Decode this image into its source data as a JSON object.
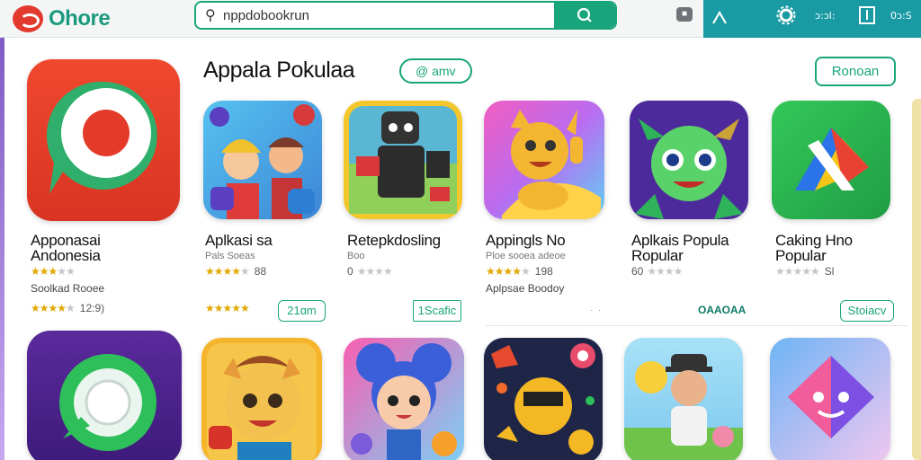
{
  "header": {
    "logo_text": "Ohore",
    "search_value": "nppdobookrun",
    "search_button_icon": "search-icon",
    "right_labels": [
      "ɔ:ɔl:",
      "0ɔ:S"
    ]
  },
  "section": {
    "title": "Appala Pokulaa",
    "chip_label": "@ amv",
    "button_label": "Ronoan"
  },
  "featured": {
    "name_line1": "Apponasai",
    "name_line2": "Andonesia",
    "rating": 3.5,
    "sub": "Soolkad Rooee",
    "rating2": 4.0,
    "rating2_value": "12:9)"
  },
  "apps_row1": [
    {
      "name_line1": "Aplkasi sa",
      "name_line2": "",
      "sub": "Pals Soeas",
      "rating": 4.5,
      "rating_value": "88",
      "extra": "",
      "rating2": 5.0,
      "button": "21ɑm"
    },
    {
      "name_line1": "Retepkdosling",
      "name_line2": "",
      "sub": "Boo",
      "rating": 0.0,
      "rating_value": "",
      "prefix": "0",
      "extra": "",
      "button": "1Scafic"
    },
    {
      "name_line1": "Appingls No",
      "name_line2": "",
      "sub": "Ploe sooea adeoe",
      "rating": 4.0,
      "rating_value": "198",
      "extra": "Aplpsae Boodoy",
      "button": ""
    },
    {
      "name_line1": "Aplkais Popula",
      "name_line2": "Ropular",
      "sub": "",
      "rating": 0.0,
      "rating_value": "",
      "prefix": "60",
      "extra": "",
      "link": "OAAOAA"
    },
    {
      "name_line1": "Caking Hno",
      "name_line2": "Popular",
      "sub": "",
      "rating": 0.0,
      "rating_value": "Sl",
      "extra": "",
      "button": "Stoiacv"
    }
  ],
  "colors": {
    "accent": "#19a57c",
    "topbar_teal": "#1a9aa3",
    "star": "#e0a800"
  },
  "icons": [
    "search-icon",
    "gear-icon",
    "bookmark-icon",
    "user-icon",
    "chart-icon"
  ]
}
